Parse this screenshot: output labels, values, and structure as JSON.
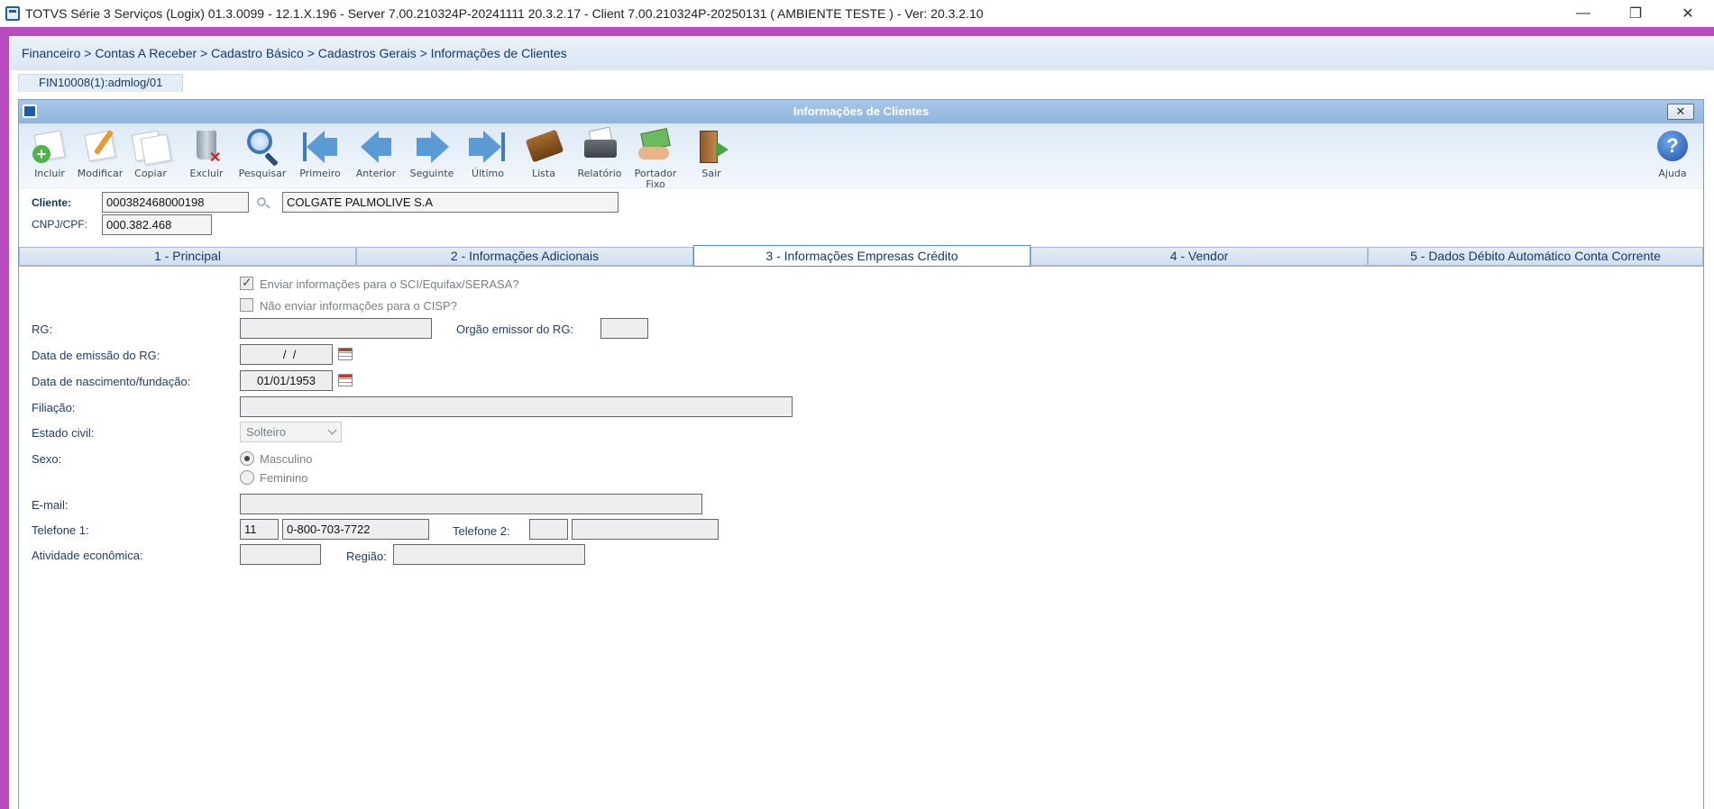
{
  "os_window": {
    "title": "TOTVS Série 3 Serviços (Logix) 01.3.0099  -  12.1.X.196 - Server 7.00.210324P-20241111 20.3.2.17 - Client 7.00.210324P-20250131    ( AMBIENTE TESTE )  - Ver: 20.3.2.10",
    "minimize": "—",
    "restore": "❐",
    "close": "✕"
  },
  "breadcrumb": "Financeiro > Contas A Receber > Cadastro Básico > Cadastros Gerais > Informações de Clientes",
  "program_tab": "FIN10008(1):admlog/01",
  "window": {
    "title": "Informações de Clientes",
    "close": "✕"
  },
  "toolbar": {
    "incluir": "Incluir",
    "modificar": "Modificar",
    "copiar": "Copiar",
    "excluir": "Excluir",
    "pesquisar": "Pesquisar",
    "primeiro": "Primeiro",
    "anterior": "Anterior",
    "seguinte": "Seguinte",
    "ultimo": "Último",
    "lista": "Lista",
    "relatorio": "Relatório",
    "portador_1": "Portador",
    "portador_2": "Fixo",
    "sair": "Sair",
    "ajuda": "Ajuda"
  },
  "client": {
    "label": "Cliente:",
    "code": "000382468000198",
    "name": "COLGATE PALMOLIVE S.A",
    "cnpj_label": "CNPJ/CPF:",
    "cnpj": "000.382.468"
  },
  "tabs": {
    "t1": "1 - Principal",
    "t2": "2 - Informações Adicionais",
    "t3": "3 - Informações Empresas Crédito",
    "t4": "4 - Vendor",
    "t5": "5 - Dados Débito Automático Conta Corrente"
  },
  "form": {
    "chk_sci": "Enviar informações para o SCI/Equifax/SERASA?",
    "chk_cisp": "Não enviar informações para o CISP?",
    "rg_label": "RG:",
    "rg_value": "",
    "orgao_label": "Orgão emissor do RG:",
    "orgao_value": "",
    "data_emissao_label": "Data de emissão do RG:",
    "data_emissao_value": "  /  /",
    "data_nasc_label": "Data de nascimento/fundação:",
    "data_nasc_value": "01/01/1953",
    "filiacao_label": "Filiação:",
    "filiacao_value": "",
    "estado_civil_label": "Estado civil:",
    "estado_civil_value": "Solteiro",
    "sexo_label": "Sexo:",
    "sexo_masculino": "Masculino",
    "sexo_feminino": "Feminino",
    "email_label": "E-mail:",
    "email_value": "",
    "tel1_label": "Telefone 1:",
    "tel1_ddd": "11",
    "tel1_number": "0-800-703-7722",
    "tel2_label": "Telefone 2:",
    "tel2_ddd": "",
    "tel2_number": "",
    "atividade_label": "Atividade econômica:",
    "atividade_value": "",
    "regiao_label": "Região:",
    "regiao_value": ""
  }
}
